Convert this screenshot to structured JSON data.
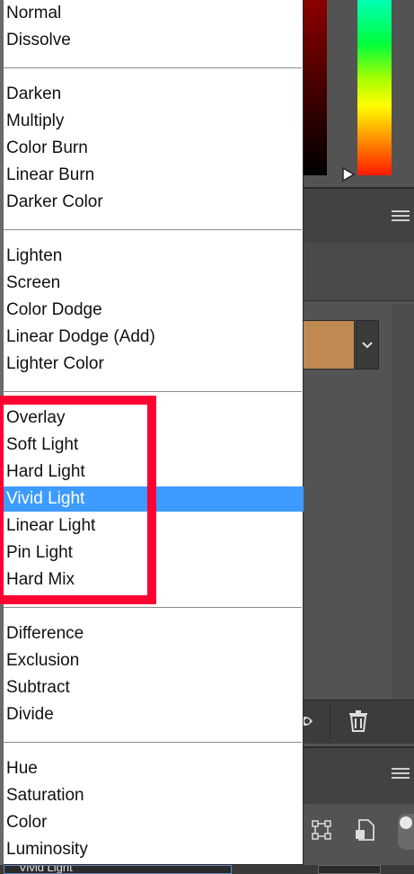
{
  "blend_menu": {
    "groups": [
      [
        "Normal",
        "Dissolve"
      ],
      [
        "Darken",
        "Multiply",
        "Color Burn",
        "Linear Burn",
        "Darker Color"
      ],
      [
        "Lighten",
        "Screen",
        "Color Dodge",
        "Linear Dodge (Add)",
        "Lighter Color"
      ],
      [
        "Overlay",
        "Soft Light",
        "Hard Light",
        "Vivid Light",
        "Linear Light",
        "Pin Light",
        "Hard Mix"
      ],
      [
        "Difference",
        "Exclusion",
        "Subtract",
        "Divide"
      ],
      [
        "Hue",
        "Saturation",
        "Color",
        "Luminosity"
      ]
    ],
    "selected": "Vivid Light"
  },
  "background": {
    "swatch_color": "#bf8a52",
    "bottom_field_text": "Vivid Light"
  },
  "colors": {
    "highlight": "#3d9bff",
    "annotation_red": "#ff0033"
  },
  "icons": [
    "panel-menu-icon",
    "chevron-down-icon",
    "eye-icon",
    "trash-icon",
    "transform-icon",
    "document-icon",
    "slider-handle-icon"
  ]
}
